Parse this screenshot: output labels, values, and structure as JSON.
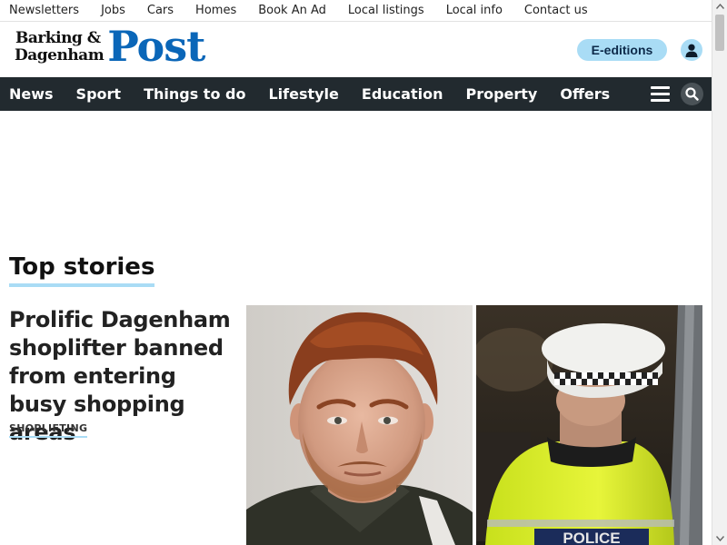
{
  "utility_nav": [
    "Newsletters",
    "Jobs",
    "Cars",
    "Homes",
    "Book An Ad",
    "Local listings",
    "Local info",
    "Contact us"
  ],
  "masthead": {
    "brand_line1": "Barking &",
    "brand_line2": "Dagenham",
    "brand_post": "Post",
    "eeditions_label": "E-editions"
  },
  "main_nav": [
    "News",
    "Sport",
    "Things to do",
    "Lifestyle",
    "Education",
    "Property",
    "Offers"
  ],
  "icons": {
    "account": "user-icon",
    "menu": "hamburger-icon",
    "search": "search-icon"
  },
  "top_stories": {
    "heading": "Top stories",
    "lead": {
      "headline": "Prolific Dagenham shoplifter banned from entering busy shopping areas",
      "tag": "SHOPLIFTING"
    },
    "right_image_text": "POLICE"
  },
  "colors": {
    "brand_blue": "#0a66b8",
    "accent_light_blue": "#a9dcf5",
    "nav_background": "#222a2f"
  }
}
